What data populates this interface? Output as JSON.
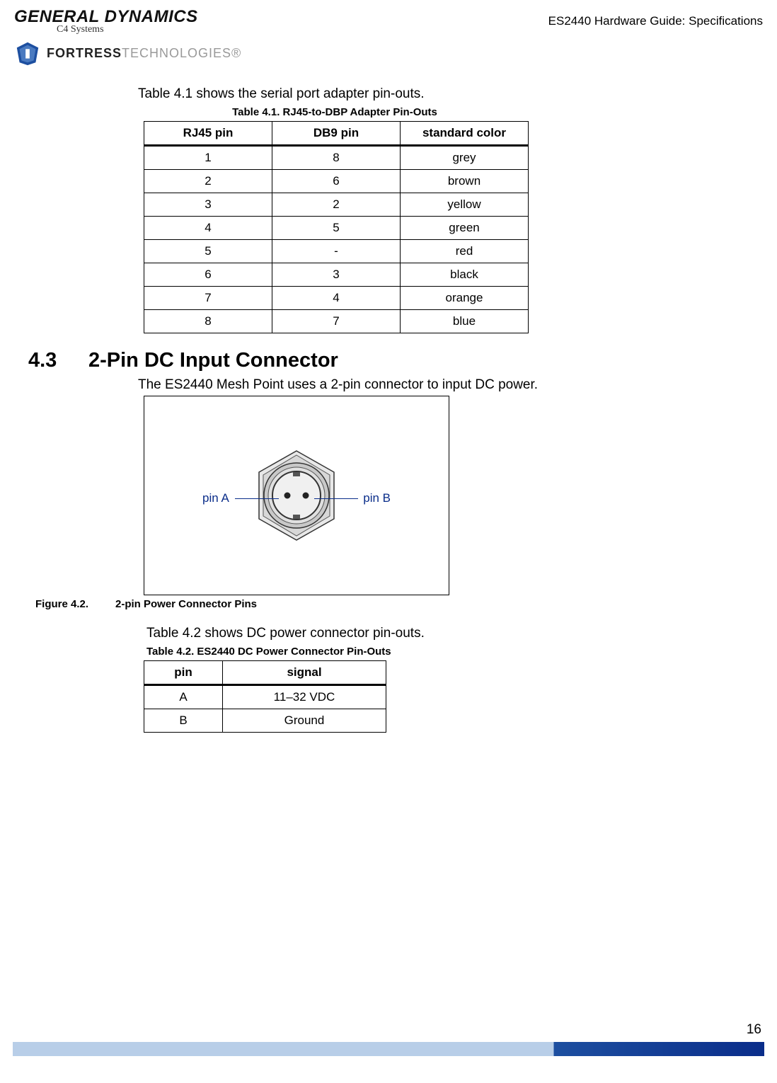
{
  "header": {
    "doc_title": "ES2440 Hardware Guide: Specifications",
    "logo_main": "GENERAL DYNAMICS",
    "logo_sub": "C4 Systems",
    "logo2_bold": "FORTRESS",
    "logo2_light": "TECHNOLOGIES"
  },
  "intro1": "Table 4.1 shows the serial port adapter pin-outs.",
  "table1": {
    "caption": "Table 4.1. RJ45-to-DBP Adapter Pin-Outs",
    "headers": [
      "RJ45 pin",
      "DB9 pin",
      "standard color"
    ],
    "rows": [
      [
        "1",
        "8",
        "grey"
      ],
      [
        "2",
        "6",
        "brown"
      ],
      [
        "3",
        "2",
        "yellow"
      ],
      [
        "4",
        "5",
        "green"
      ],
      [
        "5",
        "-",
        "red"
      ],
      [
        "6",
        "3",
        "black"
      ],
      [
        "7",
        "4",
        "orange"
      ],
      [
        "8",
        "7",
        "blue"
      ]
    ]
  },
  "section": {
    "num": "4.3",
    "title": "2-Pin DC Input Connector",
    "body": "The ES2440 Mesh Point uses a 2-pin connector to input DC power."
  },
  "figure": {
    "pinA": "pin A",
    "pinB": "pin B",
    "caption_num": "Figure 4.2.",
    "caption_title": "2-pin Power Connector Pins"
  },
  "intro2": "Table 4.2 shows DC power connector pin-outs.",
  "table2": {
    "caption": "Table 4.2. ES2440 DC Power Connector Pin-Outs",
    "headers": [
      "pin",
      "signal"
    ],
    "rows": [
      [
        "A",
        "11–32 VDC"
      ],
      [
        "B",
        "Ground"
      ]
    ]
  },
  "page_num": "16"
}
